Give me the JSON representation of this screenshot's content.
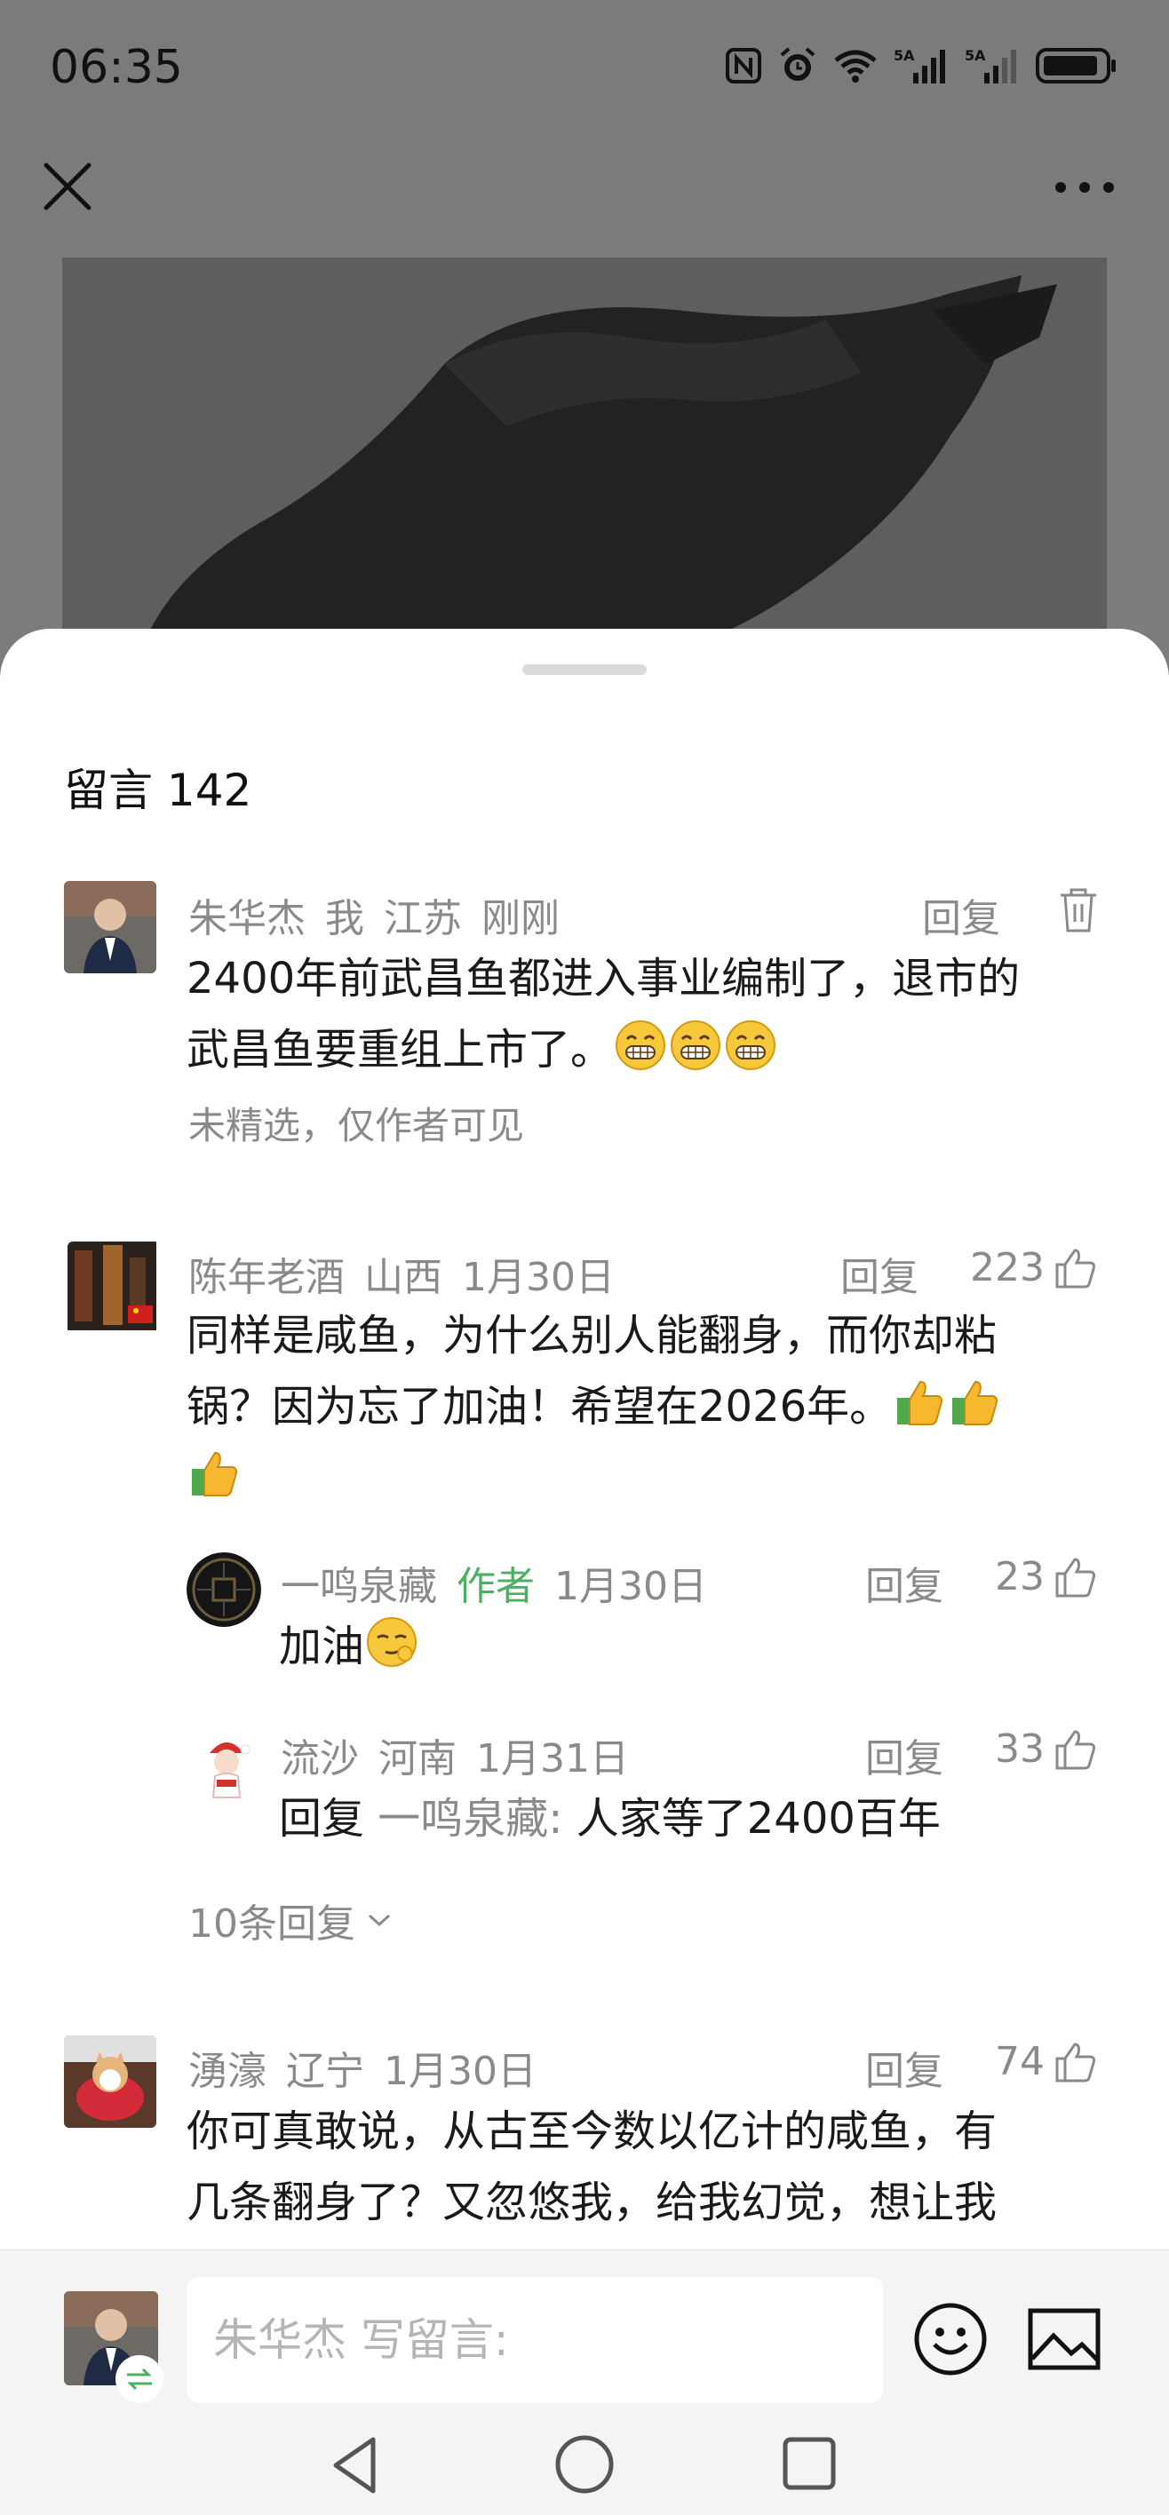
{
  "status_bar": {
    "time": "06:35",
    "icons": [
      "nfc-icon",
      "alarm-icon",
      "wifi-icon",
      "signal-5g-1-icon",
      "signal-5g-2-icon",
      "battery-icon"
    ]
  },
  "appbar": {
    "close_icon": "close-icon",
    "more_icon": "more-icon"
  },
  "sheet": {
    "title": "留言 142"
  },
  "comments": [
    {
      "user": "朱华杰",
      "tag": "我",
      "location": "江苏",
      "time": "刚刚",
      "reply_label": "回复",
      "text_line1": "2400年前武昌鱼都进入事业编制了，退市的",
      "text_line2": "武昌鱼要重组上市了。",
      "emojis": [
        "grin-emoji",
        "grin-emoji",
        "grin-emoji"
      ],
      "note": "未精选，仅作者可见"
    },
    {
      "user": "陈年老酒",
      "location": "山西",
      "time": "1月30日",
      "reply_label": "回复",
      "likes": "223",
      "text_line1": "同样是咸鱼，为什么别人能翻身，而你却粘",
      "text_line2": "锅？因为忘了加油！希望在2026年。",
      "emojis": [
        "thumbs-up-emoji",
        "thumbs-up-emoji",
        "thumbs-up-emoji"
      ],
      "replies": [
        {
          "user": "一鸣泉藏",
          "author_tag": "作者",
          "time": "1月30日",
          "reply_label": "回复",
          "likes": "23",
          "text": "加油",
          "emoji": "smirk-emoji"
        },
        {
          "user": "流沙",
          "location": "河南",
          "time": "1月31日",
          "reply_label": "回复",
          "likes": "33",
          "prefix": "回复",
          "reply_to": "一鸣泉藏:",
          "text": "人家等了2400百年"
        }
      ],
      "more_replies": "10条回复"
    },
    {
      "user": "湧濠",
      "location": "辽宁",
      "time": "1月30日",
      "reply_label": "回复",
      "likes": "74",
      "text_line1": "你可真敢说，从古至今数以亿计的咸鱼，有",
      "text_line2": "几条翻身了？又忽悠我，给我幻觉，想让我"
    }
  ],
  "input_bar": {
    "placeholder": "朱华杰 写留言:",
    "emoji_icon": "emoji-icon",
    "image_icon": "image-icon"
  },
  "nav_bar": {
    "back": "back-icon",
    "home": "home-icon",
    "recent": "recent-apps-icon"
  }
}
